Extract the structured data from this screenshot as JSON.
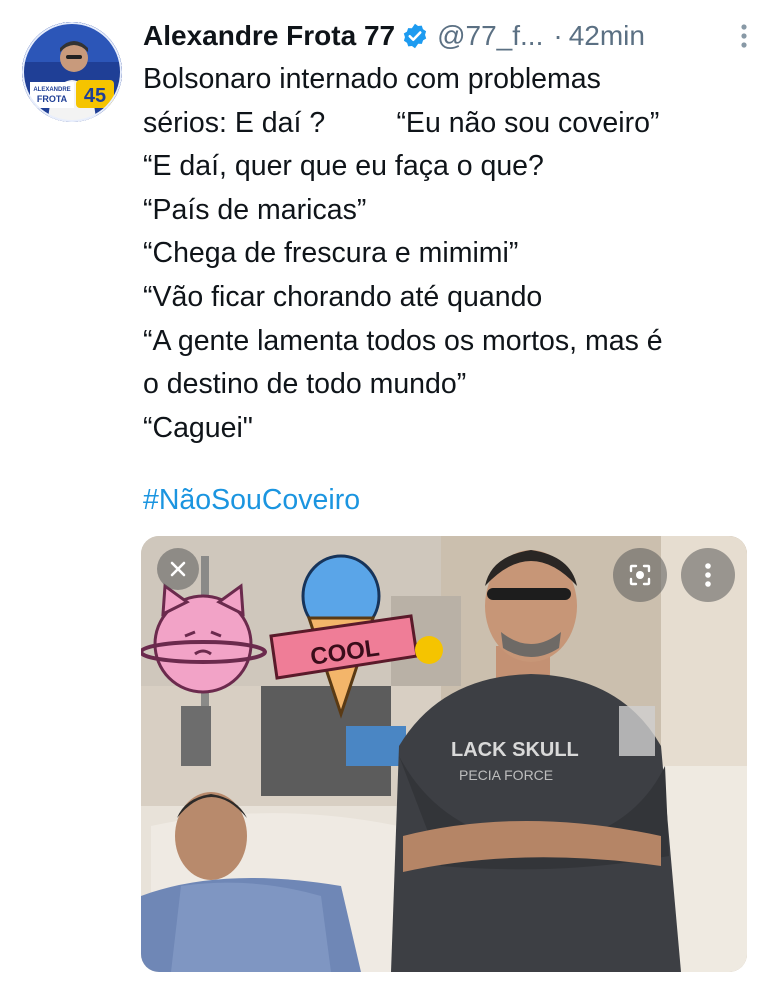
{
  "author": {
    "name": "Alexandre Frota 77",
    "handle": "@77_f...",
    "separator": "·",
    "time": "42min",
    "avatar_text_1": "ALEXANDRE",
    "avatar_text_2": "FROTA",
    "avatar_number": "45"
  },
  "tweet": {
    "lines": [
      "Bolsonaro internado com problemas",
      "sérios: E daí ?         “Eu não sou coveiro”",
      "“E daí, quer que eu faça o que?",
      "“País de maricas”",
      "“Chega de frescura e mimimi”",
      "“Vão ficar chorando até quando",
      "“A gente lamenta todos os mortos, mas é",
      "o destino de todo mundo”",
      "“Caguei\""
    ],
    "hashtag": "#NãoSouCoveiro"
  },
  "media": {
    "sticker_text": "COOL",
    "shirt_text_1": "LACK SKULL",
    "shirt_text_2": "PECIA FORCE",
    "close_icon": "close-icon",
    "lens_icon": "lens-icon",
    "more_icon": "more-vertical-icon"
  },
  "colors": {
    "text": "#0f1419",
    "secondary": "#5b7083",
    "link": "#1b95e0",
    "verified": "#1d9bf0",
    "avatar_bg": "#1f3f96"
  }
}
